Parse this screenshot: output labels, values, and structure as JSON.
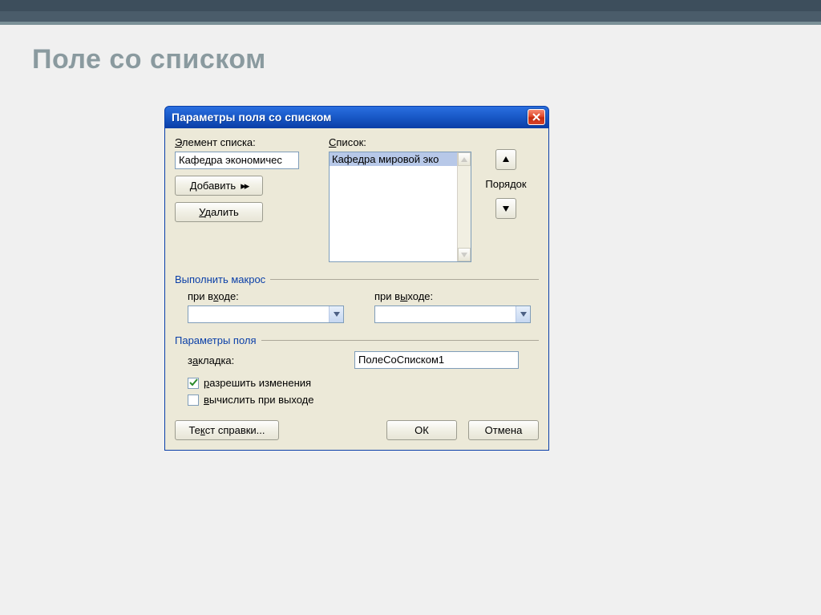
{
  "page": {
    "title": "Поле со списком"
  },
  "dialog": {
    "title": "Параметры поля со списком",
    "element_label_pre": "Э",
    "element_label_rest": "лемент списка:",
    "element_value": "Кафедра экономичес",
    "add_pre": "Д",
    "add_rest": "обавить",
    "delete_pre": "У",
    "delete_rest": "далить",
    "list_label_pre": "С",
    "list_label_rest": "писок:",
    "list_item": "Кафедра мировой эко",
    "order_label": "Порядок",
    "macros": {
      "header": "Выполнить макрос",
      "entry_pre": "при в",
      "entry_u": "х",
      "entry_rest": "оде:",
      "exit_pre": "при в",
      "exit_u": "ы",
      "exit_rest": "ходе:"
    },
    "params": {
      "header": "Параметры поля",
      "bookmark_pre": "з",
      "bookmark_u": "а",
      "bookmark_rest": "кладка:",
      "bookmark_value": "ПолеСоСписком1",
      "allow_pre": "р",
      "allow_rest": "азрешить изменения",
      "calc_pre": "в",
      "calc_rest": "ычислить при выходе"
    },
    "footer": {
      "help_pre": "Те",
      "help_u": "к",
      "help_rest": "ст справки...",
      "ok": "ОК",
      "cancel": "Отмена"
    }
  }
}
